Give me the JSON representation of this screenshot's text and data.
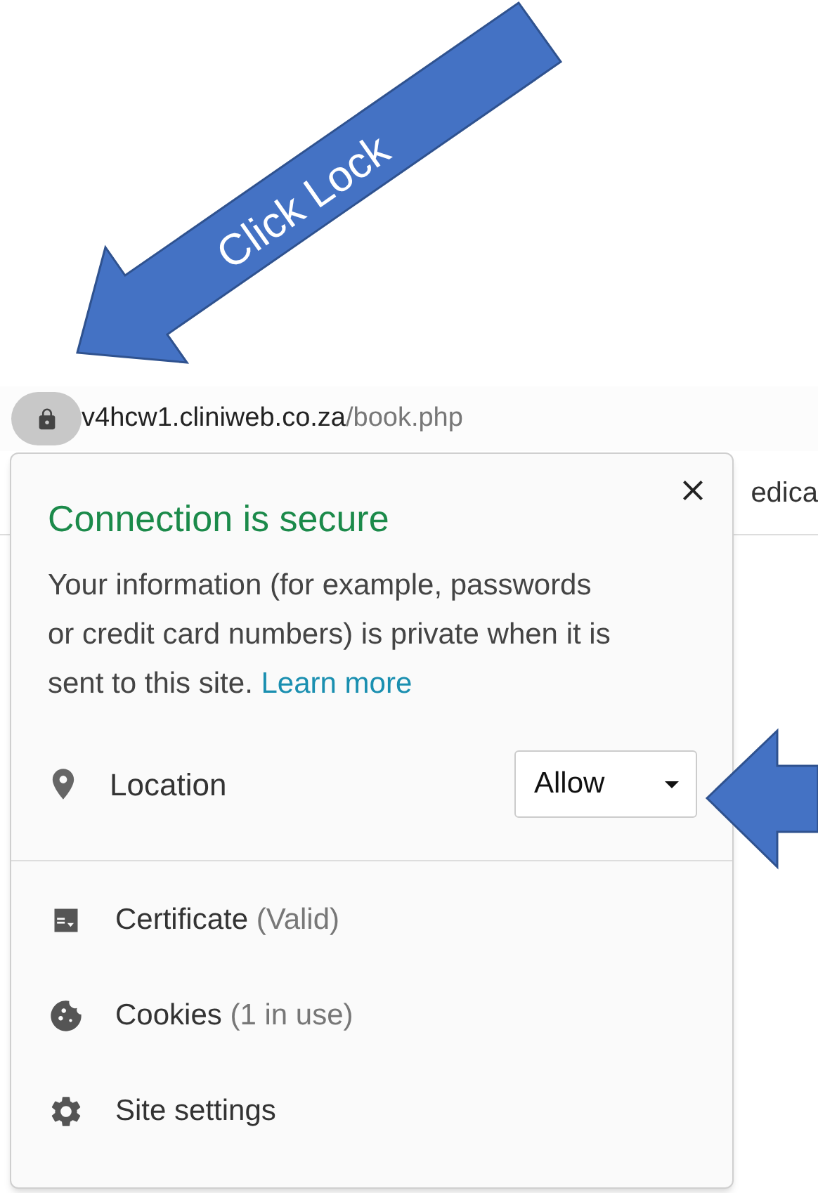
{
  "arrows": [
    {
      "kind": "labeled",
      "label": "Click Lock"
    },
    {
      "kind": "plain"
    }
  ],
  "address_bar": {
    "host": "v4hcw1.cliniweb.co.za",
    "path": "/book.php"
  },
  "background_tab": {
    "text": "edica"
  },
  "popup": {
    "title": "Connection is secure",
    "body": "Your information (for example, passwords or credit card numbers) is private when it is sent to this site.",
    "link": "Learn more",
    "permission": {
      "label": "Location",
      "value": "Allow"
    },
    "items": [
      {
        "kind": "certificate",
        "label": "Certificate",
        "detail": "(Valid)"
      },
      {
        "kind": "cookies",
        "label": "Cookies",
        "detail": "(1 in use)"
      },
      {
        "kind": "settings",
        "label": "Site settings"
      }
    ]
  }
}
